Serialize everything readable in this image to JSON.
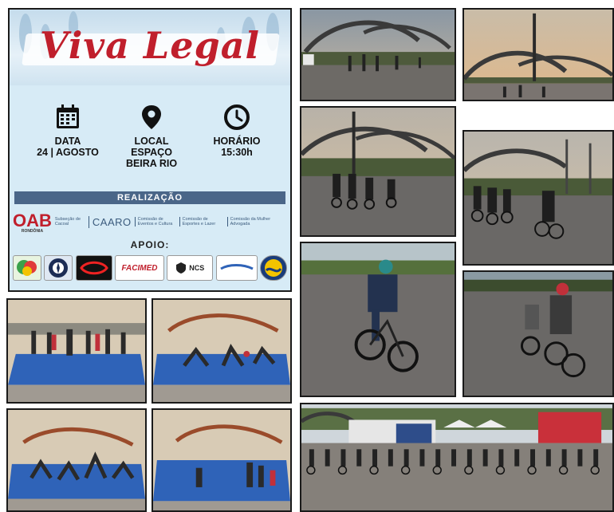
{
  "poster": {
    "title": "Viva Legal",
    "data_label": "DATA",
    "data_value": "24 | AGOSTO",
    "local_label": "LOCAL",
    "local_value_1": "ESPAÇO",
    "local_value_2": "BEIRA RIO",
    "horario_label": "HORÁRIO",
    "horario_value": "15:30h",
    "realizacao": "REALIZAÇÃO",
    "oab": "OAB",
    "oab_sub": "RONDÔNIA",
    "subsecao": "Subseção de Cacoal",
    "caaro": "CAARO",
    "comissao_1": "Comissão de Eventos e Cultura",
    "comissao_2": "Comissão de Esportes e Lazer",
    "comissao_3": "Comissão da Mulher Advogada",
    "apoio": "APOIO:",
    "sponsor_facimed": "FACIMED",
    "sponsor_ncs": "NCS"
  },
  "colors": {
    "title_red": "#c01f2c",
    "poster_bg": "#d7ebf6",
    "realizacao_bar": "#4a6688",
    "mat_blue": "#2f63b8"
  }
}
